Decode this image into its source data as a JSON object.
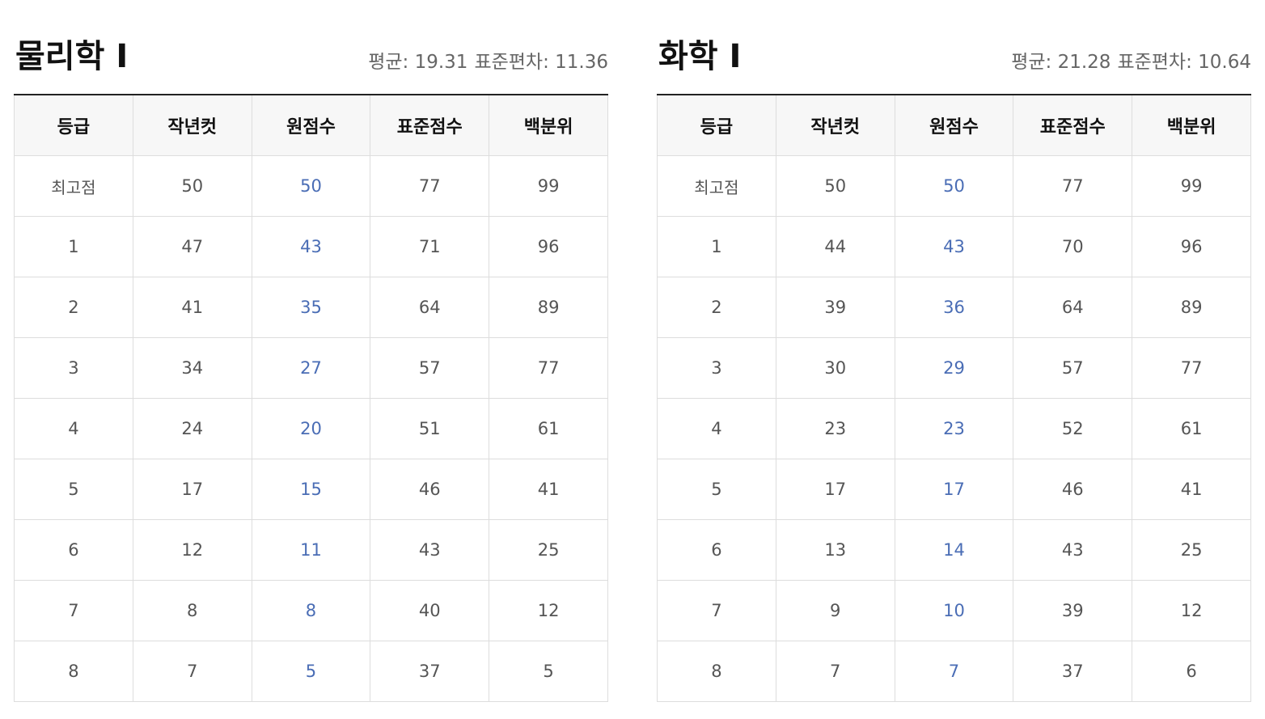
{
  "panels": [
    {
      "title": "물리학 Ⅰ",
      "stats": {
        "mean_label": "평균: 19.31",
        "sd_label": "표준편차: 11.36"
      },
      "headers": [
        "등급",
        "작년컷",
        "원점수",
        "표준점수",
        "백분위"
      ],
      "rows": [
        [
          "최고점",
          "50",
          "50",
          "77",
          "99"
        ],
        [
          "1",
          "47",
          "43",
          "71",
          "96"
        ],
        [
          "2",
          "41",
          "35",
          "64",
          "89"
        ],
        [
          "3",
          "34",
          "27",
          "57",
          "77"
        ],
        [
          "4",
          "24",
          "20",
          "51",
          "61"
        ],
        [
          "5",
          "17",
          "15",
          "46",
          "41"
        ],
        [
          "6",
          "12",
          "11",
          "43",
          "25"
        ],
        [
          "7",
          "8",
          "8",
          "40",
          "12"
        ],
        [
          "8",
          "7",
          "5",
          "37",
          "5"
        ]
      ]
    },
    {
      "title": "화학 Ⅰ",
      "stats": {
        "mean_label": "평균: 21.28",
        "sd_label": "표준편차: 10.64"
      },
      "headers": [
        "등급",
        "작년컷",
        "원점수",
        "표준점수",
        "백분위"
      ],
      "rows": [
        [
          "최고점",
          "50",
          "50",
          "77",
          "99"
        ],
        [
          "1",
          "44",
          "43",
          "70",
          "96"
        ],
        [
          "2",
          "39",
          "36",
          "64",
          "89"
        ],
        [
          "3",
          "30",
          "29",
          "57",
          "77"
        ],
        [
          "4",
          "23",
          "23",
          "52",
          "61"
        ],
        [
          "5",
          "17",
          "17",
          "46",
          "41"
        ],
        [
          "6",
          "13",
          "14",
          "43",
          "25"
        ],
        [
          "7",
          "9",
          "10",
          "39",
          "12"
        ],
        [
          "8",
          "7",
          "7",
          "37",
          "6"
        ]
      ]
    }
  ],
  "colors": {
    "raw_score": "#4a6db5",
    "header_bg": "#f7f7f7",
    "border": "#dddddd",
    "top_rule": "#222222"
  }
}
